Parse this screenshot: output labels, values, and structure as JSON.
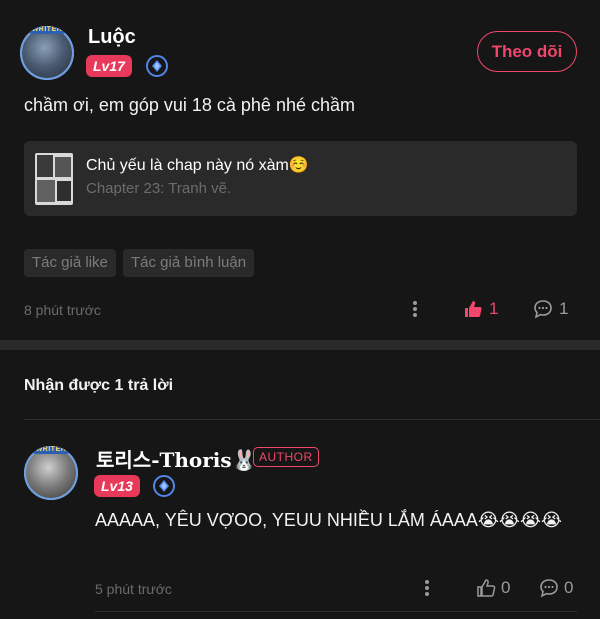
{
  "comment": {
    "username": "Luộc",
    "level": "Lv17",
    "follow_label": "Theo dõi",
    "text": "chầm ơi, em góp vui 18 cà phê nhé chầm",
    "chapter_card": {
      "title": "Chủ yếu là chap này nó xàm☺️",
      "subtitle": "Chapter 23: Tranh vẽ."
    },
    "tags": [
      "Tác giả like",
      "Tác giả bình luận"
    ],
    "time": "8 phút trước",
    "like_count": "1",
    "reply_count": "1"
  },
  "replies_header": "Nhận được 1 trả lời",
  "reply": {
    "username": "토리스-Thoris🐰",
    "author_badge": "AUTHOR",
    "level": "Lv13",
    "text": "AAAAA, YÊU VỢOO, YEUU NHIỀU LẮM ÁAAA😭😭😭😭",
    "time": "5 phút trước",
    "like_count": "0",
    "reply_count": "0"
  },
  "colors": {
    "background": "#161616",
    "accent_pink": "#f0476b",
    "level_badge": "#e8395a",
    "gem_blue": "#4f86e8",
    "card_bg": "#2a2a2a",
    "muted_text": "#6b6b6b"
  },
  "icons": {
    "verified": "diamond-gem-icon",
    "more": "more-dots-icon",
    "like": "thumbs-up-icon",
    "reply": "speech-bubble-icon"
  }
}
